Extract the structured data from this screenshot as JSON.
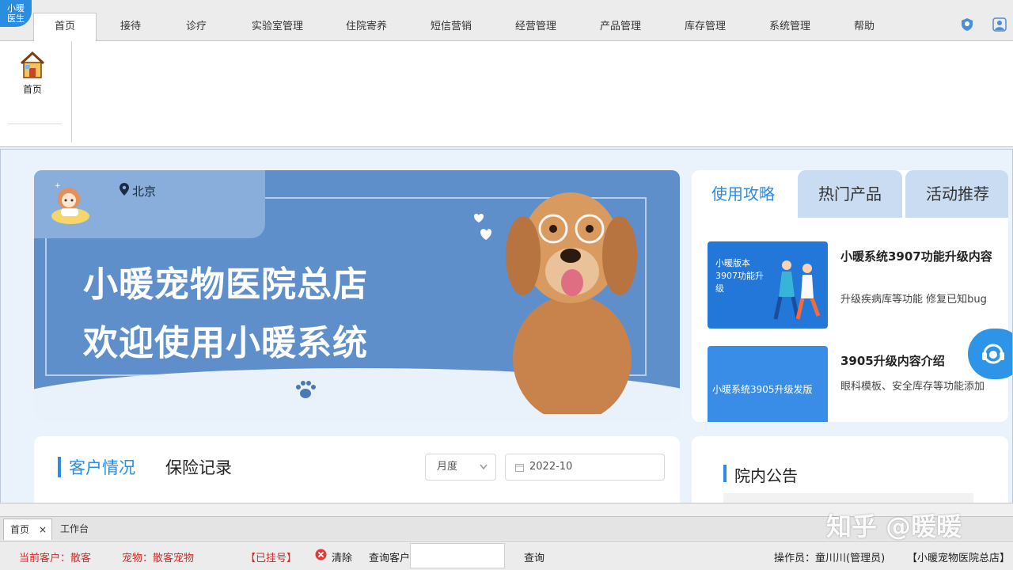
{
  "app": {
    "logo_line1": "小暖",
    "logo_line2": "医生"
  },
  "menu": {
    "tabs": [
      "首页",
      "接待",
      "诊疗",
      "实验室管理",
      "住院寄养",
      "短信营销",
      "经营管理",
      "产品管理",
      "库存管理",
      "系统管理",
      "帮助"
    ]
  },
  "ribbon": {
    "home_label": "首页"
  },
  "banner": {
    "location": "北京",
    "title": "小暖宠物医院总店",
    "subtitle": "欢迎使用小暖系统"
  },
  "rpanel": {
    "tabs": [
      "使用攻略",
      "热门产品",
      "活动推荐"
    ],
    "cards": [
      {
        "img_text": "小暖版本3907功能升级",
        "title": "小暖系统3907功能升级内容",
        "desc": "升级疾病库等功能 修复已知bug"
      },
      {
        "img_text": "小暖系统3905升级发版",
        "title": "3905升级内容介绍",
        "desc": "眼科模板、安全库存等功能添加"
      }
    ]
  },
  "customer": {
    "tab_active": "客户情况",
    "tab_other": "保险记录",
    "period_select": "月度",
    "date_value": "2022-10"
  },
  "notice": {
    "title": "院内公告"
  },
  "bottom_tabs": {
    "home": "首页",
    "workbench": "工作台"
  },
  "watermark": "知乎 @暖暖",
  "status": {
    "current_customer": "当前客户：散客",
    "pet": "宠物：散客宠物",
    "registered": "【已挂号】",
    "clear": "清除",
    "query_customer": "查询客户",
    "query": "查询",
    "operator": "操作员：童川川(管理员)",
    "store": "【小暖宠物医院总店】"
  },
  "colors": {
    "accent": "#2b8ce4",
    "banner": "#5f8fcb",
    "alert": "#d42a2a"
  },
  "icons": [
    "home-icon",
    "location-pin-icon",
    "shield-icon",
    "user-icon",
    "calendar-icon",
    "chevron-down-icon",
    "headset-icon",
    "clear-icon",
    "close-icon"
  ]
}
